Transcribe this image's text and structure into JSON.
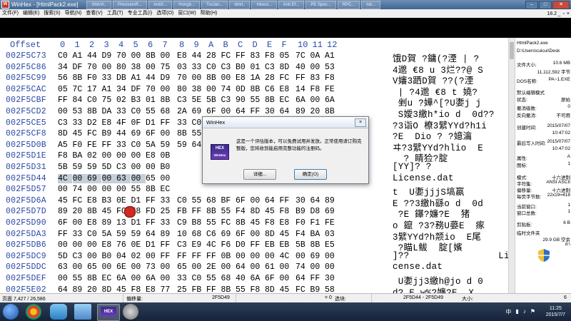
{
  "window": {
    "title": "WinHex - [HtmlPack2.exe]",
    "tabs": [
      "ShinVi..",
      "PrecisionR...",
      "AntiX...",
      "Hongb...",
      "TroJan...",
      "dmrl..",
      "Hexcv...",
      "Anti Ef...",
      "PE Spec...",
      "RPC...",
      "lstr..."
    ],
    "controls": {
      "minimize": "–",
      "maximize": "□",
      "close": "✕"
    }
  },
  "menu": {
    "items": [
      "文件(F)",
      "编辑(E)",
      "搜索(S)",
      "导航(N)",
      "查看(V)",
      "工具(T)",
      "专业工具(I)",
      "选项(O)",
      "窗口(W)",
      "帮助(H)"
    ],
    "version": "18.2",
    "controls": {
      "minimize": "_",
      "restore": "▫",
      "close": "×"
    }
  },
  "hex": {
    "header_offset": "Offset",
    "header_cols": [
      "0",
      "1",
      "2",
      "3",
      "4",
      "5",
      "6",
      "7",
      "8",
      "9",
      "A",
      "B",
      "C",
      "D",
      "E",
      "F",
      "10",
      "11",
      "12"
    ],
    "rows": [
      {
        "offset": "002F5C73",
        "bytes": [
          "C0",
          "A1",
          "44",
          "D9",
          "70",
          "00",
          "8B",
          "00",
          "E8",
          "44",
          "28",
          "FC",
          "FF",
          "83",
          "F8",
          "05",
          "7C",
          "0A",
          "A1"
        ],
        "text": "饿D賀 ?鏞(?湮 | ?"
      },
      {
        "offset": "002F5C86",
        "bytes": [
          "34",
          "DF",
          "70",
          "00",
          "80",
          "38",
          "00",
          "75",
          "03",
          "33",
          "C0",
          "C3",
          "B0",
          "01",
          "C3",
          "8D",
          "40",
          "00",
          "53"
        ],
        "text": "4邈 €8 u 3烂??@ S"
      },
      {
        "offset": "002F5C99",
        "bytes": [
          "56",
          "8B",
          "F0",
          "33",
          "DB",
          "A1",
          "44",
          "D9",
          "70",
          "00",
          "8B",
          "00",
          "E8",
          "1A",
          "28",
          "FC",
          "FF",
          "83",
          "F8"
        ],
        "text": "V嬸3跴D賀 ??(?湮"
      },
      {
        "offset": "002F5CAC",
        "bytes": [
          "05",
          "7C",
          "17",
          "A1",
          "34",
          "DF",
          "70",
          "00",
          "80",
          "38",
          "00",
          "74",
          "0D",
          "8B",
          "C6",
          "E8",
          "14",
          "F8",
          "FE"
        ],
        "text": " | ?4邈 €8 t 嬈?"
      },
      {
        "offset": "002F5CBF",
        "bytes": [
          "FF",
          "84",
          "C0",
          "75",
          "02",
          "B3",
          "01",
          "8B",
          "C3",
          "5E",
          "5B",
          "C3",
          "90",
          "55",
          "8B",
          "EC",
          "6A",
          "00",
          "6A"
        ],
        "text": " 剉u ?嬅^[?U嬱j j"
      },
      {
        "offset": "002F5CD2",
        "bytes": [
          "00",
          "53",
          "8B",
          "DA",
          "33",
          "C0",
          "55",
          "68",
          "2A",
          "69",
          "6F",
          "00",
          "64",
          "FF",
          "30",
          "64",
          "89",
          "20",
          "8B"
        ],
        "text": " S嬡3繳h*io d  0d??"
      },
      {
        "offset": "002F5CE5",
        "offset_note": "",
        "bytes": [
          "C3",
          "33",
          "D2",
          "E8",
          "4F",
          "0F",
          "D1",
          "FF",
          "33",
          "C0",
          "5A",
          "59",
          "59",
          "64",
          "89",
          "10",
          "68",
          "31",
          "69"
        ],
        "text": "?3诣O 橑3繴YYd?h1i"
      },
      {
        "offset": "002F5CF8",
        "bytes": [
          "8D",
          "45",
          "FC",
          "B9",
          "44",
          "69",
          "6F",
          "00",
          "8B",
          "55",
          "F8",
          "E8",
          "26",
          "F8",
          "FF",
          "FF",
          "...",
          "...",
          "..."
        ],
        "text": "?E  Dio ? ?嬑瀹"
      },
      {
        "offset": "002F5D0B",
        "bytes": [
          "A5",
          "F0",
          "FE",
          "FF",
          "33",
          "C0",
          "5A",
          "59",
          "59",
          "64",
          "89",
          "10",
          "68",
          "FF",
          "55",
          "8D",
          "45",
          "F8",
          "BA"
        ],
        "text": "ヰ?3繴YYd?hlio  E"
      },
      {
        "offset": "002F5D1E",
        "bytes": [
          "F8",
          "BA",
          "02",
          "00",
          "00",
          "00",
          "E8",
          "0B",
          "...",
          "...",
          "...",
          "...",
          "...",
          "...",
          "...",
          "...",
          "...",
          "...",
          "..."
        ],
        "text": "  ? 睛猃?腚"
      },
      {
        "offset": "002F5D31",
        "bytes": [
          "5B",
          "59",
          "59",
          "5D",
          "C3",
          "00",
          "00",
          "B0",
          "...",
          "...",
          "...",
          "...",
          "...",
          "...",
          "...",
          "...",
          "...",
          "...",
          "..."
        ],
        "text": "[YY]? ?"
      },
      {
        "offset": "002F5D44",
        "bytes": [
          "4C",
          "00",
          "69",
          "00",
          "63",
          "00",
          "65",
          "00",
          "...",
          "...",
          "...",
          "...",
          "...",
          "...",
          "...",
          "...",
          "...",
          "...",
          "..."
        ],
        "text": "License.dat"
      },
      {
        "offset": "002F5D57",
        "bytes": [
          "00",
          "74",
          "00",
          "00",
          "00",
          "55",
          "8B",
          "EC",
          "...",
          "...",
          "...",
          "...",
          "...",
          "...",
          "...",
          "...",
          "...",
          "...",
          "..."
        ],
        "text": "t  U嬱jjjS塙嬴"
      },
      {
        "offset": "002F5D6A",
        "bytes": [
          "45",
          "FC",
          "E8",
          "B3",
          "0E",
          "D1",
          "FF",
          "33",
          "C0",
          "55",
          "68",
          "BF",
          "6F",
          "00",
          "64",
          "FF",
          "30",
          "64",
          "89"
        ],
        "text": "E ??3繳h繇o d  0d"
      },
      {
        "offset": "002F5D7D",
        "bytes": [
          "89",
          "20",
          "8B",
          "45",
          "FC",
          "E8",
          "FD",
          "25",
          "FB",
          "FF",
          "8B",
          "55",
          "F4",
          "8D",
          "45",
          "F8",
          "B9",
          "D8",
          "69"
        ],
        "text": " ?E 鑤?嬚?E  猪"
      },
      {
        "offset": "002F5D90",
        "bytes": [
          "6F",
          "00",
          "E8",
          "89",
          "13",
          "D1",
          "FF",
          "33",
          "C9",
          "B8",
          "55",
          "FC",
          "8B",
          "45",
          "F8",
          "E8",
          "F0",
          "F1",
          "FE"
        ],
        "text": "o 鑹 ?3?務U嬊E  瘃"
      },
      {
        "offset": "002F5DA3",
        "bytes": [
          "FF",
          "33",
          "C0",
          "5A",
          "59",
          "59",
          "64",
          "89",
          "10",
          "68",
          "C6",
          "69",
          "6F",
          "00",
          "8D",
          "45",
          "F4",
          "BA",
          "03"
        ],
        "text": "3繴YYd?h颒io  E尾"
      },
      {
        "offset": "002F5DB6",
        "bytes": [
          "00",
          "00",
          "00",
          "E8",
          "76",
          "0E",
          "D1",
          "FF",
          "C3",
          "E9",
          "4C",
          "F6",
          "D0",
          "FF",
          "EB",
          "EB",
          "5B",
          "8B",
          "E5"
        ],
        "text": " ?瞄L鲅  腚[嬪"
      },
      {
        "offset": "002F5DC9",
        "bytes": [
          "5D",
          "C3",
          "00",
          "B0",
          "04",
          "02",
          "00",
          "FF",
          "FF",
          "FF",
          "FF",
          "0B",
          "00",
          "00",
          "00",
          "4C",
          "00",
          "69",
          "00"
        ],
        "text": "]??                Li"
      },
      {
        "offset": "002F5DDC",
        "bytes": [
          "63",
          "00",
          "65",
          "00",
          "6E",
          "00",
          "73",
          "00",
          "65",
          "00",
          "2E",
          "00",
          "64",
          "00",
          "61",
          "00",
          "74",
          "00",
          "00"
        ],
        "text": "cense.dat"
      },
      {
        "offset": "002F5DEF",
        "bytes": [
          "00",
          "55",
          "8B",
          "EC",
          "6A",
          "00",
          "6A",
          "00",
          "33",
          "C0",
          "55",
          "68",
          "40",
          "6A",
          "6F",
          "00",
          "64",
          "FF",
          "30"
        ],
        "text": " U嬱jj3繳h@jo d 0"
      },
      {
        "offset": "002F5E02",
        "bytes": [
          "64",
          "89",
          "20",
          "8D",
          "45",
          "F8",
          "E8",
          "77",
          "25",
          "FB",
          "FF",
          "8B",
          "55",
          "F8",
          "8D",
          "45",
          "FC",
          "B9",
          "58"
        ],
        "text": "d? E w%?嬚?E  X"
      }
    ]
  },
  "info_panel": {
    "filename": "HtmlPack2.exe",
    "path": "D:\\Users\\cuicui\\Desk",
    "size_label": "文件大小:",
    "size_mb": "10.6 MB",
    "size_bytes": "11,112,592 字节",
    "dos_name": "DOS名称:",
    "dos_value": "PA~1.EXE",
    "edit_mode_label": "默认编辑模式",
    "status_label": "状态:",
    "status_value": "原始",
    "undo_label": "撤消级数:",
    "undo_value": "0",
    "undo_reverse_label": "反向撤消:",
    "undo_reverse_value": "不可用",
    "created_label": "创建时间:",
    "created_date": "2015/07/07",
    "created_time": "10:47:02",
    "modified_label": "最后写入时间:",
    "modified_date": "2015/07/07",
    "modified_time": "10:47:02",
    "attr_label": "属性:",
    "attr_value": "A",
    "icon_label": "图标:",
    "icon_value": "1",
    "mode_label": "模式:",
    "mode_value": "十六进制",
    "charset_label": "字符集:",
    "charset_value": "ANSI ASCII",
    "offset_label": "偏移量:",
    "offset_value": "十六进制",
    "bytes_per_page_label": "每页字节数:",
    "bytes_per_page_value": "22x19=418",
    "cur_window_label": "当前窗口:",
    "cur_window_value": "1",
    "window_count_label": "窗口总数:",
    "window_count_value": "1",
    "clipboard_label": "剪贴板:",
    "clipboard_value": "6 B",
    "temp_label": "临时文件夹",
    "temp_value": "29.9 GB 空余",
    "temp_path": "d:\\"
  },
  "status": {
    "page": "页面 7,427 / 26,586",
    "offset_label": "偏移量:",
    "offset_value": "2F5D49",
    "eq": "= 0",
    "selection_label": "选块:",
    "selection_range": "2F5D44 - 2F5D49",
    "size_label": "大小:",
    "size_value": "6"
  },
  "dialog": {
    "title": "WinHex",
    "logo_top": "HEX",
    "logo_bottom": "WinHex",
    "message": "这是一个评估版本，可以免费试用并发放。正常使用请订购完整版，您将收到能启用完整功能的注册码。",
    "details_button": "详细...",
    "ok_button": "确定(O)"
  },
  "taskbar": {
    "time": "11:25",
    "date": "2015/7/7",
    "tray_icons": [
      "ch-icon",
      "network-icon",
      "volume-icon",
      "flag-icon"
    ]
  }
}
